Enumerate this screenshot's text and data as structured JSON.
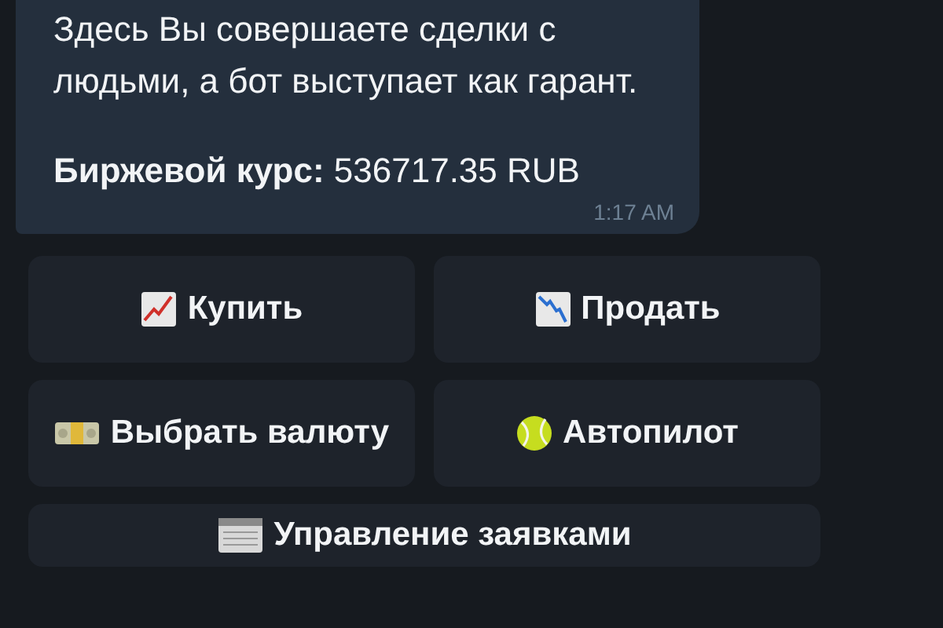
{
  "message": {
    "text": "Здесь Вы совершаете сделки с людьми, а бот выступает как гарант.",
    "rate": "**Биржевой курс:** 536717.35 RUB",
    "time": "1:17 AM"
  },
  "keyboard": [
    [
      {
        "label": "Купить"
      },
      {
        "label": "Продать"
      }
    ],
    [
      {
        "label": "Выбрать валюту"
      },
      {
        "label": "Автопилот"
      }
    ],
    [
      {
        "label": "Управление заявками"
      }
    ]
  ]
}
